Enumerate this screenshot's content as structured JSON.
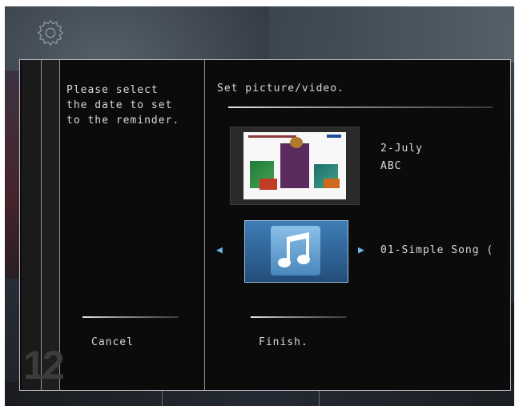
{
  "dialog": {
    "instruction": "Please select the date to set to the reminder.",
    "title": "Set picture/video.",
    "date": "2-July",
    "event_name": "ABC",
    "music_label": "01-Simple Song (",
    "cancel_label": "Cancel",
    "finish_label": "Finish.",
    "day_digit": "12"
  },
  "icons": {
    "settings": "gear-icon",
    "prev": "left-arrow-icon",
    "next": "right-arrow-icon",
    "music": "music-note-icon"
  },
  "colors": {
    "accent": "#6db7e8",
    "panel": "#0b0b0b",
    "text": "#d8d8d8"
  }
}
